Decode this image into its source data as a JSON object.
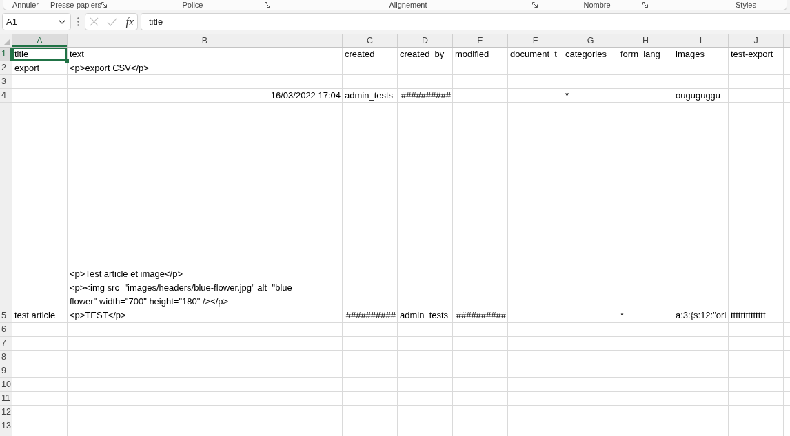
{
  "ribbon": {
    "groups": [
      {
        "label": "Annuler",
        "launcher": false
      },
      {
        "label": "Presse-papiers",
        "launcher": true
      },
      {
        "label": "Police",
        "launcher": true
      },
      {
        "label": "Alignement",
        "launcher": true
      },
      {
        "label": "Nombre",
        "launcher": true
      },
      {
        "label": "Styles",
        "launcher": false
      }
    ]
  },
  "formula_bar": {
    "name_box": "A1",
    "cancel": {
      "disabled": true
    },
    "enter": {
      "disabled": true
    },
    "function_button": "fx",
    "value": "title"
  },
  "sheet": {
    "columns": [
      {
        "label": "A",
        "selected": true
      },
      {
        "label": "B",
        "selected": false
      },
      {
        "label": "C",
        "selected": false
      },
      {
        "label": "D",
        "selected": false
      },
      {
        "label": "E",
        "selected": false
      },
      {
        "label": "F",
        "selected": false
      },
      {
        "label": "G",
        "selected": false
      },
      {
        "label": "H",
        "selected": false
      },
      {
        "label": "I",
        "selected": false
      },
      {
        "label": "J",
        "selected": false
      }
    ],
    "rows": [
      {
        "label": "1",
        "selected": true,
        "cells": [
          {
            "kind": "text",
            "text": "title",
            "selected": true
          },
          {
            "kind": "text",
            "text": "text",
            "selected": false
          },
          {
            "kind": "text",
            "text": "created",
            "selected": false
          },
          {
            "kind": "text",
            "text": "created_by",
            "selected": false
          },
          {
            "kind": "text",
            "text": "modified",
            "selected": false
          },
          {
            "kind": "text",
            "text": "document_t",
            "selected": false
          },
          {
            "kind": "text",
            "text": "categories",
            "selected": false
          },
          {
            "kind": "text",
            "text": "form_lang",
            "selected": false
          },
          {
            "kind": "text",
            "text": "images",
            "selected": false
          },
          {
            "kind": "text",
            "text": "test-export",
            "selected": false
          }
        ]
      },
      {
        "label": "2",
        "selected": false,
        "cells": [
          {
            "kind": "text",
            "text": "export",
            "selected": false
          },
          {
            "kind": "text",
            "text": "<p>export CSV</p>",
            "selected": false
          }
        ]
      },
      {
        "label": "3",
        "selected": false
      },
      {
        "label": "4",
        "selected": false,
        "cells": [
          null,
          {
            "kind": "number",
            "text": "16/03/2022 17:04",
            "selected": false
          },
          {
            "kind": "text",
            "text": "admin_tests",
            "selected": false
          },
          {
            "kind": "number",
            "text": "##########",
            "selected": false
          },
          null,
          null,
          {
            "kind": "text",
            "text": "*",
            "selected": false
          },
          null,
          {
            "kind": "text",
            "text": "ouguguggu",
            "selected": false
          }
        ]
      },
      {
        "label": "5",
        "selected": false,
        "cells": [
          {
            "kind": "text",
            "text": "test article",
            "selected": false
          },
          {
            "kind": "text",
            "text": "<p>Test article et image</p>\n<p><img src=\"images/headers/blue-flower.jpg\" alt=\"blue\nflower\" width=\"700\" height=\"180\" /></p>\n<p>TEST</p>",
            "selected": false
          },
          {
            "kind": "number",
            "text": "##########",
            "selected": false
          },
          {
            "kind": "text",
            "text": "admin_tests",
            "selected": false
          },
          {
            "kind": "number",
            "text": "##########",
            "selected": false
          },
          null,
          null,
          {
            "kind": "text",
            "text": "*",
            "selected": false
          },
          {
            "kind": "text",
            "text": "a:3:{s:12:\"ori",
            "selected": false
          },
          {
            "kind": "text",
            "text": "tttttttttttttt",
            "selected": false
          }
        ]
      },
      {
        "label": "6",
        "selected": false
      },
      {
        "label": "7",
        "selected": false
      },
      {
        "label": "8",
        "selected": false
      },
      {
        "label": "9",
        "selected": false
      },
      {
        "label": "10",
        "selected": false
      },
      {
        "label": "11",
        "selected": false
      },
      {
        "label": "12",
        "selected": false
      },
      {
        "label": "13",
        "selected": false
      }
    ]
  }
}
